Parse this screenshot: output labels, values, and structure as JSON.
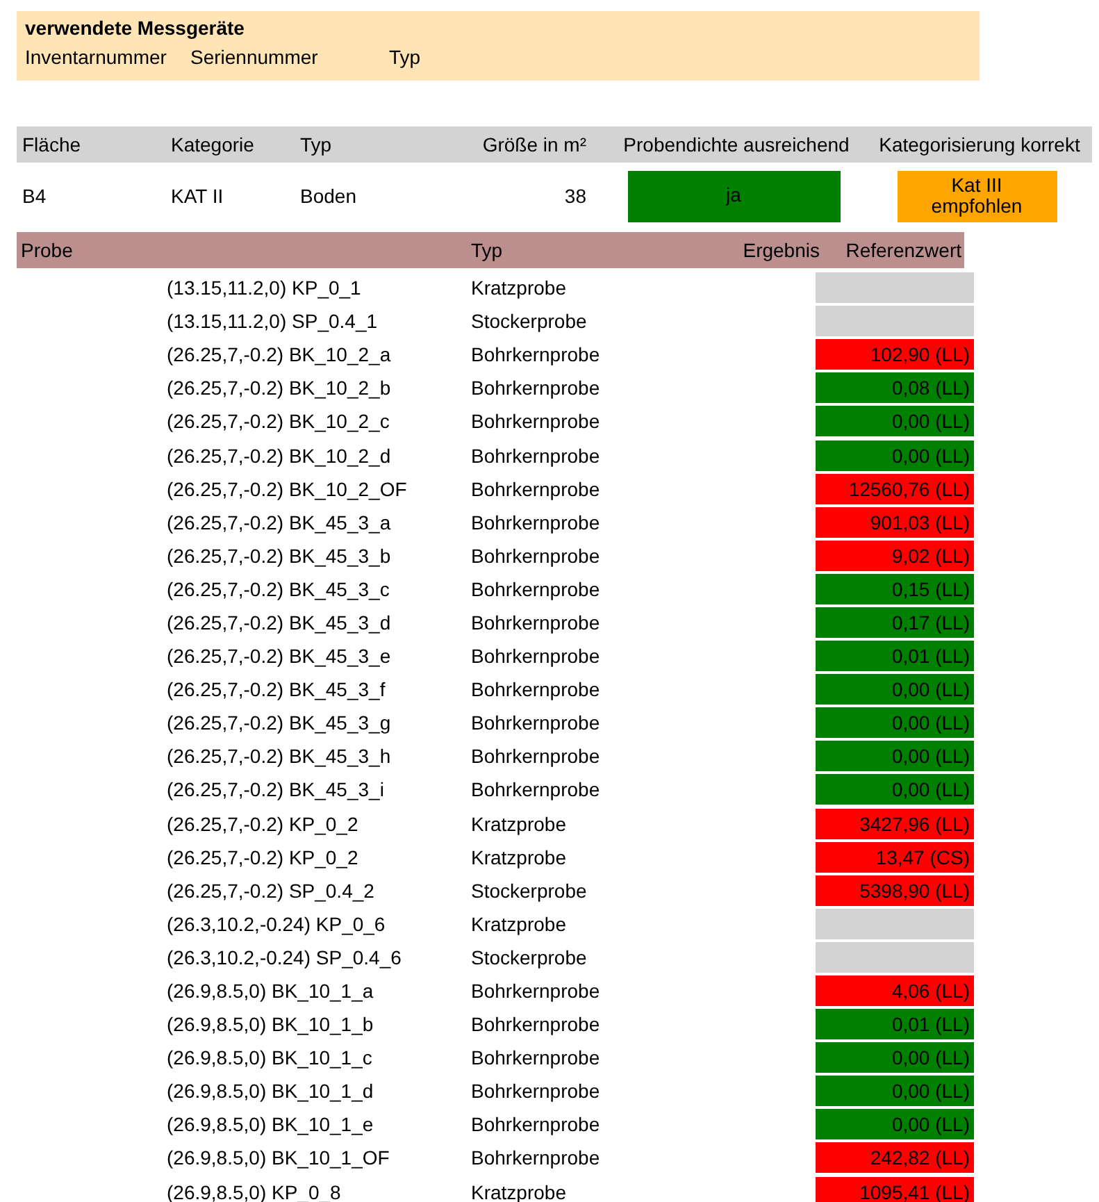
{
  "devices": {
    "title": "verwendete Messgeräte",
    "columns": [
      "Inventarnummer",
      "Seriennummer",
      "Typ"
    ]
  },
  "area_table": {
    "columns": [
      "Fläche",
      "Kategorie",
      "Typ",
      "Größe in m²",
      "Probendichte ausreichend",
      "Kategorisierung korrekt"
    ],
    "row": {
      "flaeche": "B4",
      "kategorie": "KAT II",
      "typ": "Boden",
      "groesse": "38",
      "probendichte": {
        "text": "ja",
        "color": "#008000"
      },
      "kategorisierung": {
        "text": "Kat III empfohlen",
        "color": "#ffa500"
      }
    }
  },
  "samples": {
    "columns": [
      "Probe",
      "Typ",
      "Ergebnis",
      "Referenzwert"
    ],
    "rows": [
      {
        "probe": "(13.15,11.2,0) KP_0_1",
        "typ": "Kratzprobe",
        "referenzwert": "",
        "color": "#d3d3d3"
      },
      {
        "probe": "(13.15,11.2,0) SP_0.4_1",
        "typ": "Stockerprobe",
        "referenzwert": "",
        "color": "#d3d3d3"
      },
      {
        "probe": "(26.25,7,-0.2) BK_10_2_a",
        "typ": "Bohrkernprobe",
        "referenzwert": "102,90 (LL)",
        "color": "#ff0000"
      },
      {
        "probe": "(26.25,7,-0.2) BK_10_2_b",
        "typ": "Bohrkernprobe",
        "referenzwert": "0,08 (LL)",
        "color": "#008000"
      },
      {
        "probe": "(26.25,7,-0.2) BK_10_2_c",
        "typ": "Bohrkernprobe",
        "referenzwert": "0,00 (LL)",
        "color": "#008000"
      },
      {
        "probe": "(26.25,7,-0.2) BK_10_2_d",
        "typ": "Bohrkernprobe",
        "referenzwert": "0,00 (LL)",
        "color": "#008000"
      },
      {
        "probe": "(26.25,7,-0.2) BK_10_2_OF",
        "typ": "Bohrkernprobe",
        "referenzwert": "12560,76 (LL)",
        "color": "#ff0000"
      },
      {
        "probe": "(26.25,7,-0.2) BK_45_3_a",
        "typ": "Bohrkernprobe",
        "referenzwert": "901,03 (LL)",
        "color": "#ff0000"
      },
      {
        "probe": "(26.25,7,-0.2) BK_45_3_b",
        "typ": "Bohrkernprobe",
        "referenzwert": "9,02 (LL)",
        "color": "#ff0000"
      },
      {
        "probe": "(26.25,7,-0.2) BK_45_3_c",
        "typ": "Bohrkernprobe",
        "referenzwert": "0,15 (LL)",
        "color": "#008000"
      },
      {
        "probe": "(26.25,7,-0.2) BK_45_3_d",
        "typ": "Bohrkernprobe",
        "referenzwert": "0,17 (LL)",
        "color": "#008000"
      },
      {
        "probe": "(26.25,7,-0.2) BK_45_3_e",
        "typ": "Bohrkernprobe",
        "referenzwert": "0,01 (LL)",
        "color": "#008000"
      },
      {
        "probe": "(26.25,7,-0.2) BK_45_3_f",
        "typ": "Bohrkernprobe",
        "referenzwert": "0,00 (LL)",
        "color": "#008000"
      },
      {
        "probe": "(26.25,7,-0.2) BK_45_3_g",
        "typ": "Bohrkernprobe",
        "referenzwert": "0,00 (LL)",
        "color": "#008000"
      },
      {
        "probe": "(26.25,7,-0.2) BK_45_3_h",
        "typ": "Bohrkernprobe",
        "referenzwert": "0,00 (LL)",
        "color": "#008000"
      },
      {
        "probe": "(26.25,7,-0.2) BK_45_3_i",
        "typ": "Bohrkernprobe",
        "referenzwert": "0,00 (LL)",
        "color": "#008000"
      },
      {
        "probe": "(26.25,7,-0.2) KP_0_2",
        "typ": "Kratzprobe",
        "referenzwert": "3427,96 (LL)",
        "color": "#ff0000"
      },
      {
        "probe": "(26.25,7,-0.2) KP_0_2",
        "typ": "Kratzprobe",
        "referenzwert": "13,47 (CS)",
        "color": "#ff0000"
      },
      {
        "probe": "(26.25,7,-0.2) SP_0.4_2",
        "typ": "Stockerprobe",
        "referenzwert": "5398,90 (LL)",
        "color": "#ff0000"
      },
      {
        "probe": "(26.3,10.2,-0.24) KP_0_6",
        "typ": "Kratzprobe",
        "referenzwert": "",
        "color": "#d3d3d3"
      },
      {
        "probe": "(26.3,10.2,-0.24) SP_0.4_6",
        "typ": "Stockerprobe",
        "referenzwert": "",
        "color": "#d3d3d3"
      },
      {
        "probe": "(26.9,8.5,0) BK_10_1_a",
        "typ": "Bohrkernprobe",
        "referenzwert": "4,06 (LL)",
        "color": "#ff0000"
      },
      {
        "probe": "(26.9,8.5,0) BK_10_1_b",
        "typ": "Bohrkernprobe",
        "referenzwert": "0,01 (LL)",
        "color": "#008000"
      },
      {
        "probe": "(26.9,8.5,0) BK_10_1_c",
        "typ": "Bohrkernprobe",
        "referenzwert": "0,00 (LL)",
        "color": "#008000"
      },
      {
        "probe": "(26.9,8.5,0) BK_10_1_d",
        "typ": "Bohrkernprobe",
        "referenzwert": "0,00 (LL)",
        "color": "#008000"
      },
      {
        "probe": "(26.9,8.5,0) BK_10_1_e",
        "typ": "Bohrkernprobe",
        "referenzwert": "0,00 (LL)",
        "color": "#008000"
      },
      {
        "probe": "(26.9,8.5,0) BK_10_1_OF",
        "typ": "Bohrkernprobe",
        "referenzwert": "242,82 (LL)",
        "color": "#ff0000"
      },
      {
        "probe": "(26.9,8.5,0) KP_0_8",
        "typ": "Kratzprobe",
        "referenzwert": "1095,41 (LL)",
        "color": "#ff0000"
      }
    ]
  }
}
